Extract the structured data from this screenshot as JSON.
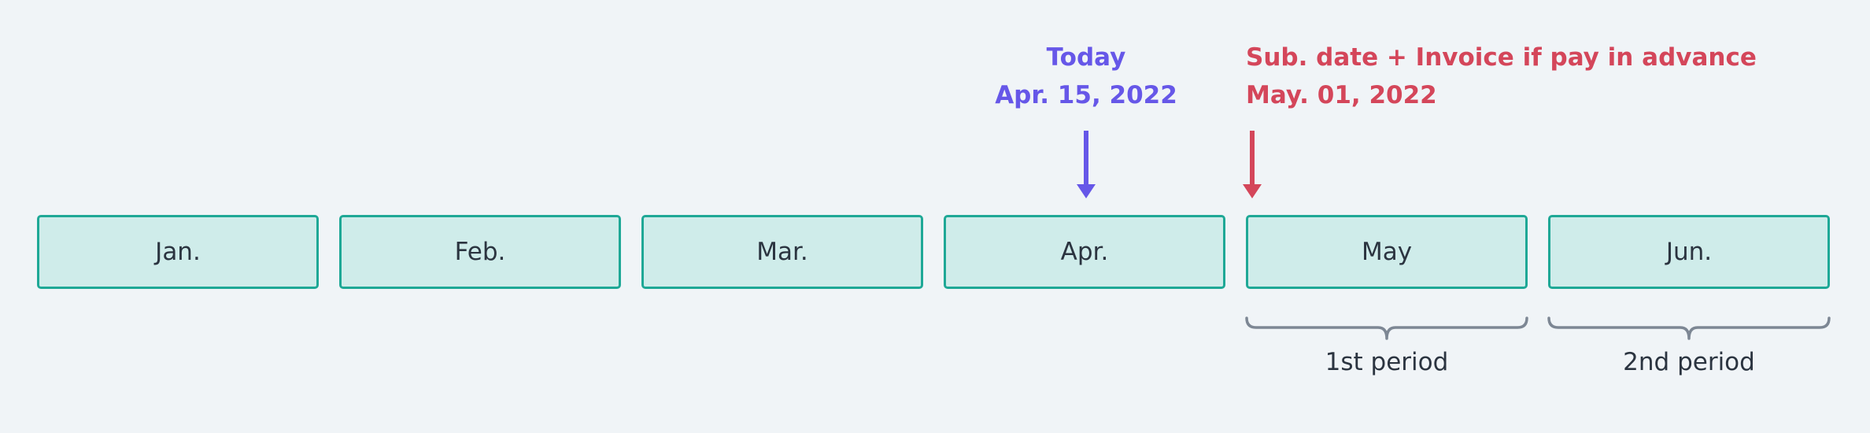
{
  "months": [
    "Jan.",
    "Feb.",
    "Mar.",
    "Apr.",
    "May",
    "Jun."
  ],
  "today": {
    "title": "Today",
    "date": "Apr. 15, 2022",
    "color": "#6657e8"
  },
  "subscription": {
    "title": "Sub. date + Invoice if pay in advance",
    "date": "May. 01, 2022",
    "color": "#d4465a"
  },
  "periods": [
    "1st period",
    "2nd period"
  ],
  "colors": {
    "background": "#f0f4f7",
    "box_border": "#1ea896",
    "box_fill": "#cfecea",
    "brace": "#7d8794",
    "text": "#2b3440"
  }
}
